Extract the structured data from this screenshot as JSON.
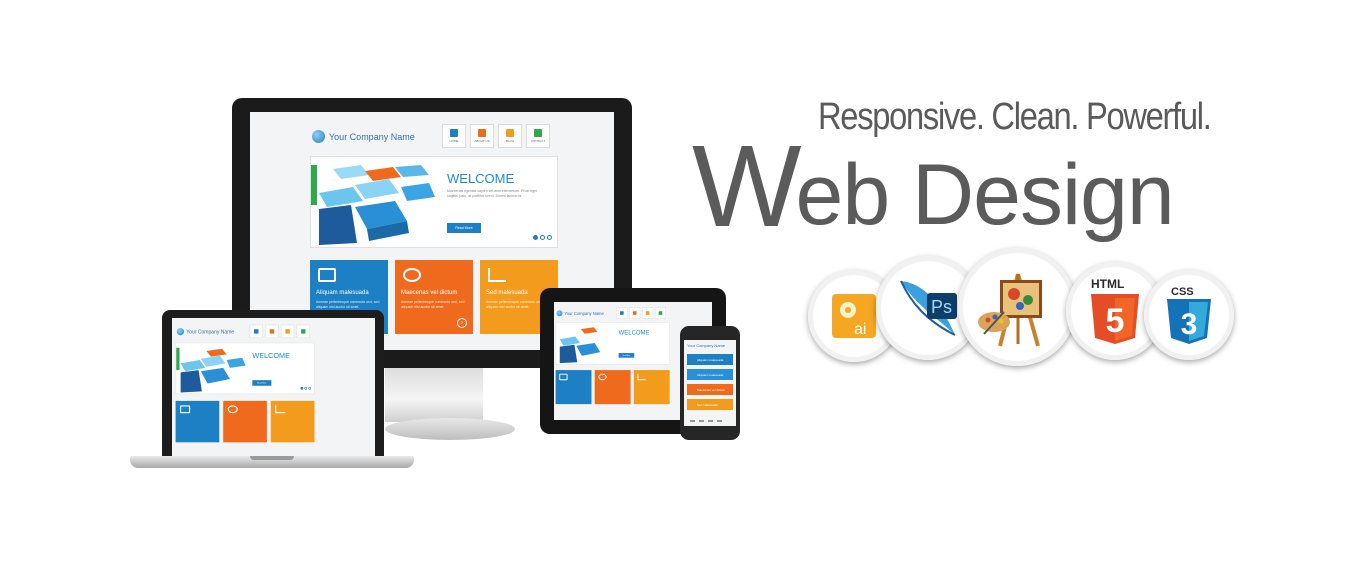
{
  "banner": {
    "tagline": "Responsive. Clean. Powerful.",
    "headline_first_letter": "W",
    "headline_rest": "eb Design"
  },
  "site_mockup": {
    "logo_text": "Your Company Name",
    "nav": [
      {
        "label": "HOME",
        "color": "#1d7fc4"
      },
      {
        "label": "ABOUT US",
        "color": "#f06a1e"
      },
      {
        "label": "BLOG",
        "color": "#f29b1c"
      },
      {
        "label": "CONTACT",
        "color": "#2eaa4a"
      }
    ],
    "hero_title": "WELCOME",
    "hero_text": "Maecenas egestas sapien vel ante elementum. Proin eget sagittis justo, at porttitor lorem. Donec lacinia mi.",
    "hero_button": "Read More",
    "tiles": [
      {
        "title": "Aliquam malesuada",
        "text": "Aenean pellentesque commodo orci, sed aliquam nisi auctor sit amet.",
        "color": "#1d7fc4",
        "icon": "gallery-icon"
      },
      {
        "title": "Maecenas vel dictum",
        "text": "Aenean pellentesque commodo orci, sed aliquam nisi auctor sit amet.",
        "color": "#f06a1e",
        "icon": "globe-icon"
      },
      {
        "title": "Sed malesuada",
        "text": "Aenean pellentesque commodo orci, sed aliquam nisi auctor sit amet.",
        "color": "#f29b1c",
        "icon": "chart-icon"
      }
    ]
  },
  "badges": [
    {
      "name": "illustrator-badge",
      "icon": "illustrator-icon",
      "label": "ai"
    },
    {
      "name": "photoshop-badge",
      "icon": "photoshop-feather-icon",
      "label": "Ps"
    },
    {
      "name": "paint-easel-badge",
      "icon": "easel-palette-icon",
      "label": ""
    },
    {
      "name": "html5-badge",
      "icon": "html5-shield-icon",
      "label": "HTML",
      "number": "5"
    },
    {
      "name": "css3-badge",
      "icon": "css3-shield-icon",
      "label": "CSS",
      "number": "3"
    }
  ],
  "colors": {
    "text_gray": "#5b5b5b",
    "brand_blue": "#1d7fc4",
    "brand_orange": "#f06a1e",
    "brand_amber": "#f29b1c"
  }
}
